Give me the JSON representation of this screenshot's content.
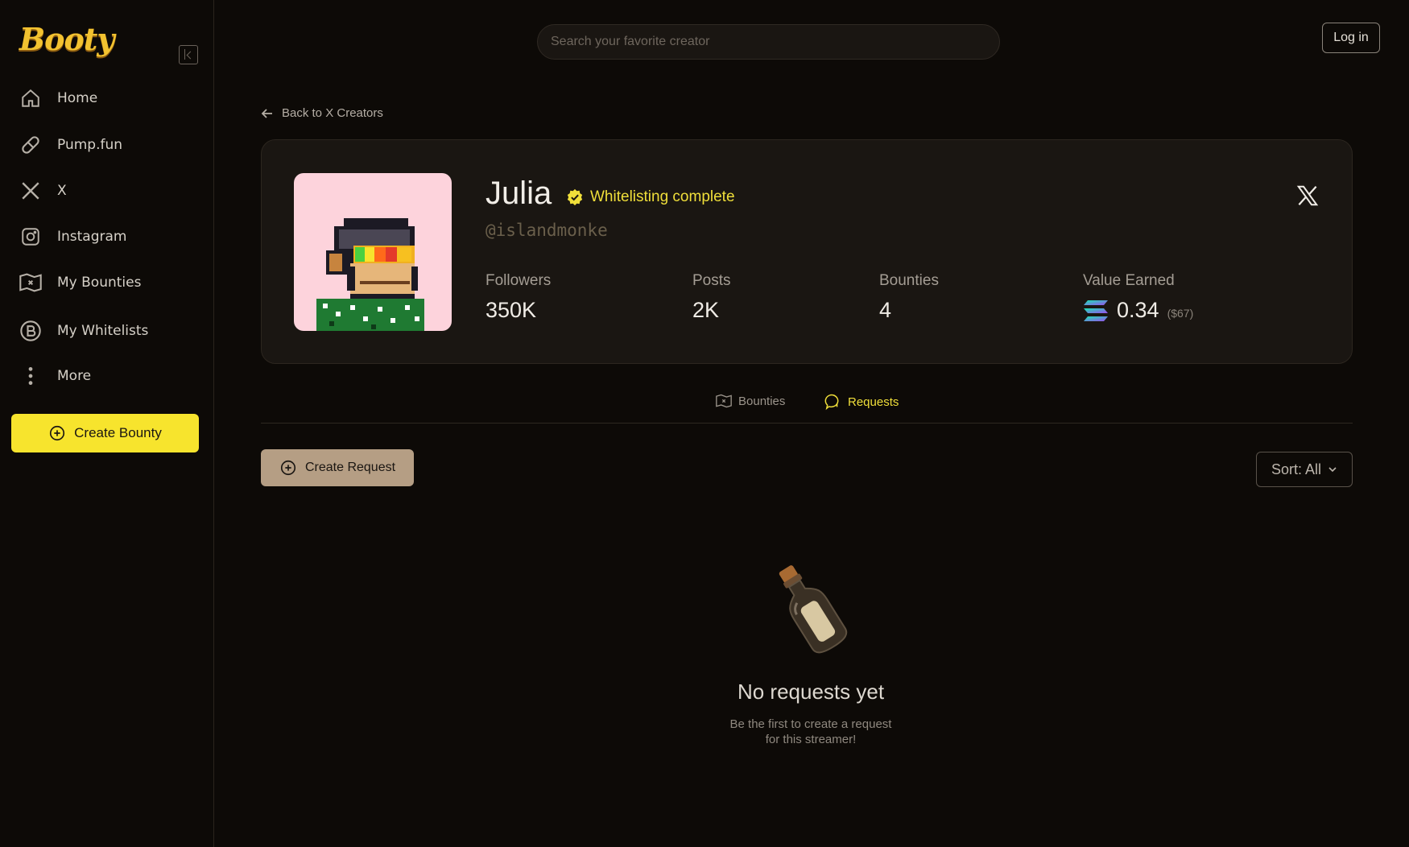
{
  "brand": {
    "logo_text": "Booty",
    "accent": "#f7e42d"
  },
  "sidebar": {
    "items": [
      {
        "label": "Home",
        "icon": "home-icon"
      },
      {
        "label": "Pump.fun",
        "icon": "pill-icon"
      },
      {
        "label": "X",
        "icon": "x-logo-icon"
      },
      {
        "label": "Instagram",
        "icon": "instagram-icon"
      },
      {
        "label": "My Bounties",
        "icon": "treasure-map-icon"
      },
      {
        "label": "My Whitelists",
        "icon": "b-coin-icon"
      },
      {
        "label": "More",
        "icon": "more-vertical-icon"
      }
    ],
    "create_bounty_label": "Create Bounty"
  },
  "header": {
    "search_placeholder": "Search your favorite creator",
    "login_label": "Log in"
  },
  "back_link": "Back to X Creators",
  "profile": {
    "name": "Julia",
    "status": "Whitelisting complete",
    "handle": "@islandmonke",
    "stats": [
      {
        "label": "Followers",
        "value": "350K"
      },
      {
        "label": "Posts",
        "value": "2K"
      },
      {
        "label": "Bounties",
        "value": "4"
      },
      {
        "label": "Value Earned",
        "value": "0.34",
        "usd": "($67)",
        "icon": "solana-icon"
      }
    ]
  },
  "tabs": [
    {
      "label": "Bounties",
      "icon": "treasure-map-icon",
      "active": false
    },
    {
      "label": "Requests",
      "icon": "chat-bubble-icon",
      "active": true
    }
  ],
  "actions": {
    "create_request_label": "Create Request",
    "sort_label": "Sort: All"
  },
  "empty_state": {
    "title": "No requests yet",
    "subtitle_line1": "Be the first to create a request",
    "subtitle_line2": "for this streamer!",
    "icon": "message-bottle-icon"
  }
}
